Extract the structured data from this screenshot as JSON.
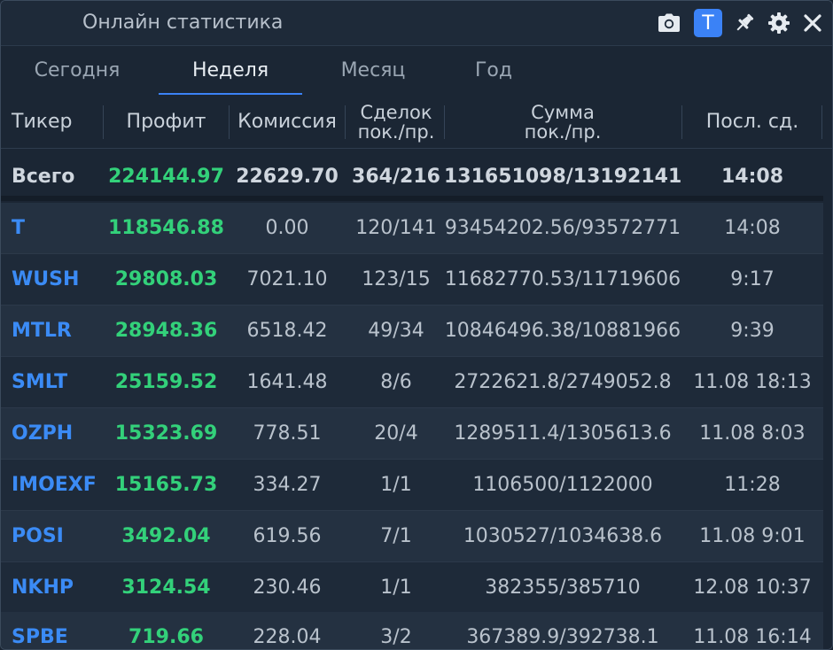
{
  "window": {
    "title": "Онлайн статистика"
  },
  "toolbar": {
    "t_label": "T"
  },
  "tabs": [
    {
      "label": "Сегодня",
      "active": false
    },
    {
      "label": "Неделя",
      "active": true
    },
    {
      "label": "Месяц",
      "active": false
    },
    {
      "label": "Год",
      "active": false
    }
  ],
  "columns": {
    "ticker": "Тикер",
    "profit": "Профит",
    "commission": "Комиссия",
    "deals_line1": "Сделок",
    "deals_line2": "пок./пр.",
    "sum_line1": "Сумма",
    "sum_line2": "пок./пр.",
    "last": "Посл. сд."
  },
  "total": {
    "ticker": "Всего",
    "profit": "224144.97",
    "commission": "22629.70",
    "deals": "364/216",
    "sum": "131651098/13192141",
    "last": "14:08"
  },
  "rows": [
    {
      "ticker": "T",
      "profit": "118546.88",
      "commission": "0.00",
      "deals": "120/141",
      "sum": "93454202.56/93572771",
      "last": "14:08"
    },
    {
      "ticker": "WUSH",
      "profit": "29808.03",
      "commission": "7021.10",
      "deals": "123/15",
      "sum": "11682770.53/11719606",
      "last": "9:17"
    },
    {
      "ticker": "MTLR",
      "profit": "28948.36",
      "commission": "6518.42",
      "deals": "49/34",
      "sum": "10846496.38/10881966",
      "last": "9:39"
    },
    {
      "ticker": "SMLT",
      "profit": "25159.52",
      "commission": "1641.48",
      "deals": "8/6",
      "sum": "2722621.8/2749052.8",
      "last": "11.08 18:13"
    },
    {
      "ticker": "OZPH",
      "profit": "15323.69",
      "commission": "778.51",
      "deals": "20/4",
      "sum": "1289511.4/1305613.6",
      "last": "11.08 8:03"
    },
    {
      "ticker": "IMOEXF",
      "profit": "15165.73",
      "commission": "334.27",
      "deals": "1/1",
      "sum": "1106500/1122000",
      "last": "11:28"
    },
    {
      "ticker": "POSI",
      "profit": "3492.04",
      "commission": "619.56",
      "deals": "7/1",
      "sum": "1030527/1034638.6",
      "last": "11.08 9:01"
    },
    {
      "ticker": "NKHP",
      "profit": "3124.54",
      "commission": "230.46",
      "deals": "1/1",
      "sum": "382355/385710",
      "last": "12.08 10:37"
    },
    {
      "ticker": "SPBE",
      "profit": "719.66",
      "commission": "228.04",
      "deals": "3/2",
      "sum": "367389.9/392738.1",
      "last": "11.08 16:14"
    }
  ],
  "colors": {
    "accent": "#3b82f6",
    "profit": "#33d17a",
    "ticker": "#3b8bf5"
  }
}
